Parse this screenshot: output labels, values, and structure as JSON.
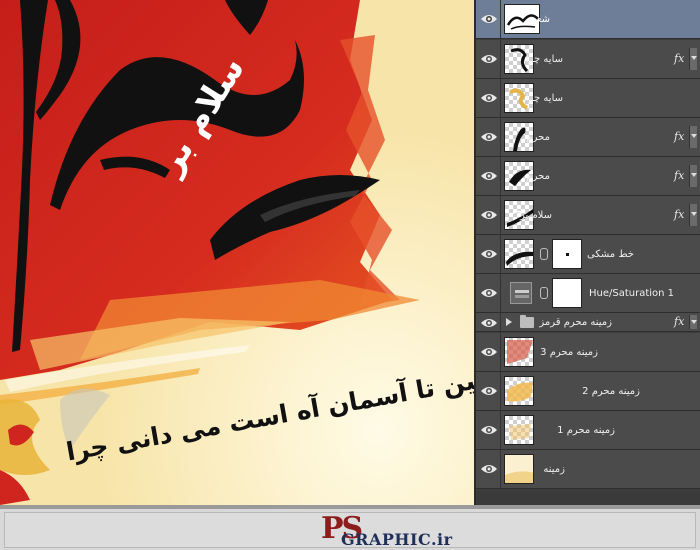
{
  "canvas": {
    "salam_text": "سلام بر",
    "poem_text": "از زمین تا آسمان آه است می دانی چرا"
  },
  "layers_panel": {
    "layers": [
      {
        "name": "شعر",
        "selected": true,
        "fx": false,
        "thumb": "poem-thumb"
      },
      {
        "name": "سایه چرا",
        "selected": false,
        "fx": true,
        "thumb": "shadow-chera-thumb"
      },
      {
        "name": "سایه چرا",
        "selected": false,
        "fx": false,
        "thumb": "shadow-chera-gold-thumb"
      },
      {
        "name": "محرم",
        "selected": false,
        "fx": true,
        "thumb": "moharram-thumb"
      },
      {
        "name": "محرم",
        "selected": false,
        "fx": true,
        "thumb": "moharram-thumb"
      },
      {
        "name": "سلام بر",
        "selected": false,
        "fx": true,
        "thumb": "salam-thumb"
      },
      {
        "name": "خط مشکی",
        "selected": false,
        "fx": false,
        "thumb": "brush-stroke-thumb",
        "has_mask": true
      },
      {
        "name": "Hue/Saturation 1",
        "selected": false,
        "fx": false,
        "thumb": "adjustment-icon",
        "has_mask": true
      },
      {
        "name": "زمینه محرم قرمز",
        "selected": false,
        "fx": true,
        "thumb": "folder-icon",
        "is_group": true
      },
      {
        "name": "زمینه محرم 3",
        "selected": false,
        "fx": false,
        "thumb": "red-texture-thumb"
      },
      {
        "name": "زمینه محرم 2",
        "selected": false,
        "fx": false,
        "thumb": "gold-texture-thumb"
      },
      {
        "name": "زمینه محرم 1",
        "selected": false,
        "fx": false,
        "thumb": "texture-thumb"
      },
      {
        "name": "زمینه",
        "selected": false,
        "fx": false,
        "thumb": "background-thumb"
      }
    ],
    "fx_label": "fx"
  },
  "footer": {
    "logo_ps": "PS",
    "logo_graphic": "GRAPHIC.ir"
  },
  "colors": {
    "canvas_red": "#d0251e",
    "canvas_cream": "#fbf1cf",
    "panel_bg": "#4b4b4b",
    "selected_layer": "#6f7e98",
    "logo_red": "#8c1d1d",
    "logo_navy": "#1f2f5a"
  }
}
